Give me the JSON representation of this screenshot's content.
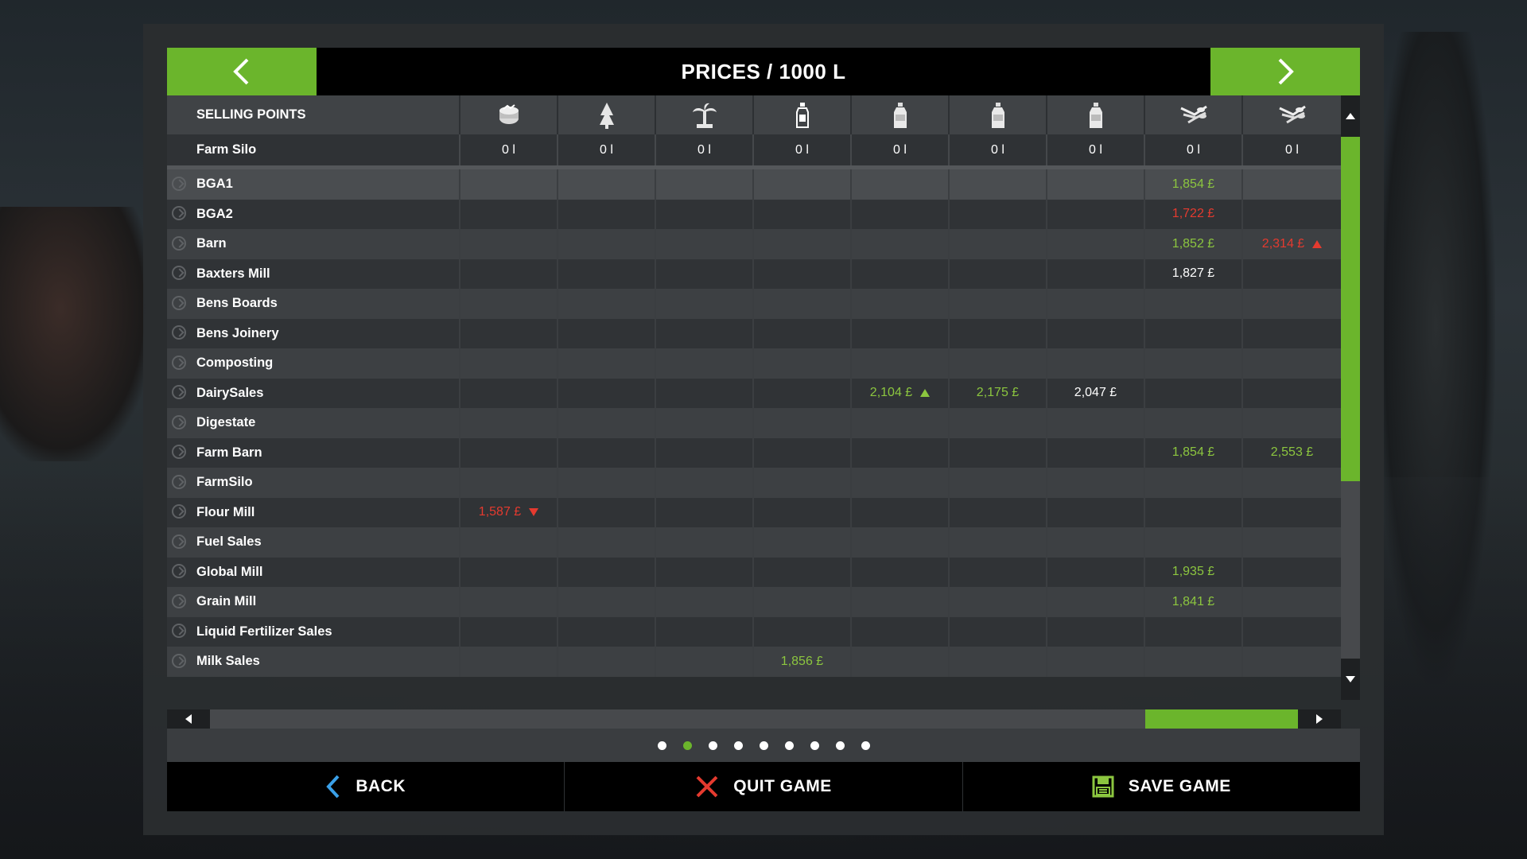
{
  "title": "PRICES / 1000 L",
  "header": {
    "selling_points_label": "SELLING POINTS",
    "columns": [
      {
        "icon": "fermented-feed-icon"
      },
      {
        "icon": "tree-icon"
      },
      {
        "icon": "palm-tree-icon"
      },
      {
        "icon": "bottle-icon"
      },
      {
        "icon": "milk-bottle-icon"
      },
      {
        "icon": "milk-bottle-icon"
      },
      {
        "icon": "milk-bottle-icon"
      },
      {
        "icon": "crops-icon"
      },
      {
        "icon": "crops-icon"
      }
    ]
  },
  "farm_silo": {
    "label": "Farm Silo",
    "values": [
      "0 l",
      "0 l",
      "0 l",
      "0 l",
      "0 l",
      "0 l",
      "0 l",
      "0 l",
      "0 l"
    ]
  },
  "rows": [
    {
      "name": "BGA1",
      "cells": [
        "",
        "",
        "",
        "",
        "",
        "",
        "",
        {
          "v": "1,854 £",
          "c": "green"
        },
        ""
      ]
    },
    {
      "name": "BGA2",
      "cells": [
        "",
        "",
        "",
        "",
        "",
        "",
        "",
        {
          "v": "1,722 £",
          "c": "red"
        },
        ""
      ]
    },
    {
      "name": "Barn",
      "cells": [
        "",
        "",
        "",
        "",
        "",
        "",
        "",
        {
          "v": "1,852 £",
          "c": "green"
        },
        {
          "v": "2,314 £",
          "c": "red",
          "t": "up"
        }
      ]
    },
    {
      "name": "Baxters Mill",
      "cells": [
        "",
        "",
        "",
        "",
        "",
        "",
        "",
        {
          "v": "1,827 £",
          "c": "white"
        },
        ""
      ]
    },
    {
      "name": "Bens Boards",
      "cells": [
        "",
        "",
        "",
        "",
        "",
        "",
        "",
        "",
        ""
      ]
    },
    {
      "name": "Bens Joinery",
      "cells": [
        "",
        "",
        "",
        "",
        "",
        "",
        "",
        "",
        ""
      ]
    },
    {
      "name": "Composting",
      "cells": [
        "",
        "",
        "",
        "",
        "",
        "",
        "",
        "",
        ""
      ]
    },
    {
      "name": "DairySales",
      "cells": [
        "",
        "",
        "",
        "",
        {
          "v": "2,104 £",
          "c": "green",
          "t": "up"
        },
        {
          "v": "2,175 £",
          "c": "green"
        },
        {
          "v": "2,047 £",
          "c": "white"
        },
        "",
        ""
      ]
    },
    {
      "name": "Digestate",
      "cells": [
        "",
        "",
        "",
        "",
        "",
        "",
        "",
        "",
        ""
      ]
    },
    {
      "name": "Farm Barn",
      "cells": [
        "",
        "",
        "",
        "",
        "",
        "",
        "",
        {
          "v": "1,854 £",
          "c": "green"
        },
        {
          "v": "2,553 £",
          "c": "green"
        }
      ]
    },
    {
      "name": "FarmSilo",
      "cells": [
        "",
        "",
        "",
        "",
        "",
        "",
        "",
        "",
        ""
      ]
    },
    {
      "name": "Flour Mill",
      "cells": [
        {
          "v": "1,587 £",
          "c": "red",
          "t": "down"
        },
        "",
        "",
        "",
        "",
        "",
        "",
        "",
        ""
      ]
    },
    {
      "name": "Fuel Sales",
      "cells": [
        "",
        "",
        "",
        "",
        "",
        "",
        "",
        "",
        ""
      ]
    },
    {
      "name": "Global Mill",
      "cells": [
        "",
        "",
        "",
        "",
        "",
        "",
        "",
        {
          "v": "1,935 £",
          "c": "green"
        },
        ""
      ]
    },
    {
      "name": "Grain Mill",
      "cells": [
        "",
        "",
        "",
        "",
        "",
        "",
        "",
        {
          "v": "1,841 £",
          "c": "green"
        },
        ""
      ]
    },
    {
      "name": "Liquid Fertilizer Sales",
      "cells": [
        "",
        "",
        "",
        "",
        "",
        "",
        "",
        "",
        ""
      ]
    },
    {
      "name": "Milk Sales",
      "cells": [
        "",
        "",
        "",
        {
          "v": "1,856 £",
          "c": "green"
        },
        "",
        "",
        "",
        "",
        ""
      ]
    }
  ],
  "scroll": {
    "vertical_position": 0.0,
    "vertical_visible": 0.66,
    "horizontal_position": 0.86,
    "horizontal_visible": 0.14
  },
  "pager": {
    "count": 9,
    "active_index": 1
  },
  "bottom": {
    "back_label": "BACK",
    "quit_label": "QUIT GAME",
    "save_label": "SAVE GAME"
  },
  "colors": {
    "accent": "#6bb52c",
    "positive": "#8cc63f",
    "negative": "#e53a2f",
    "back_icon": "#3aa0e8",
    "quit_icon": "#e53a2f"
  }
}
